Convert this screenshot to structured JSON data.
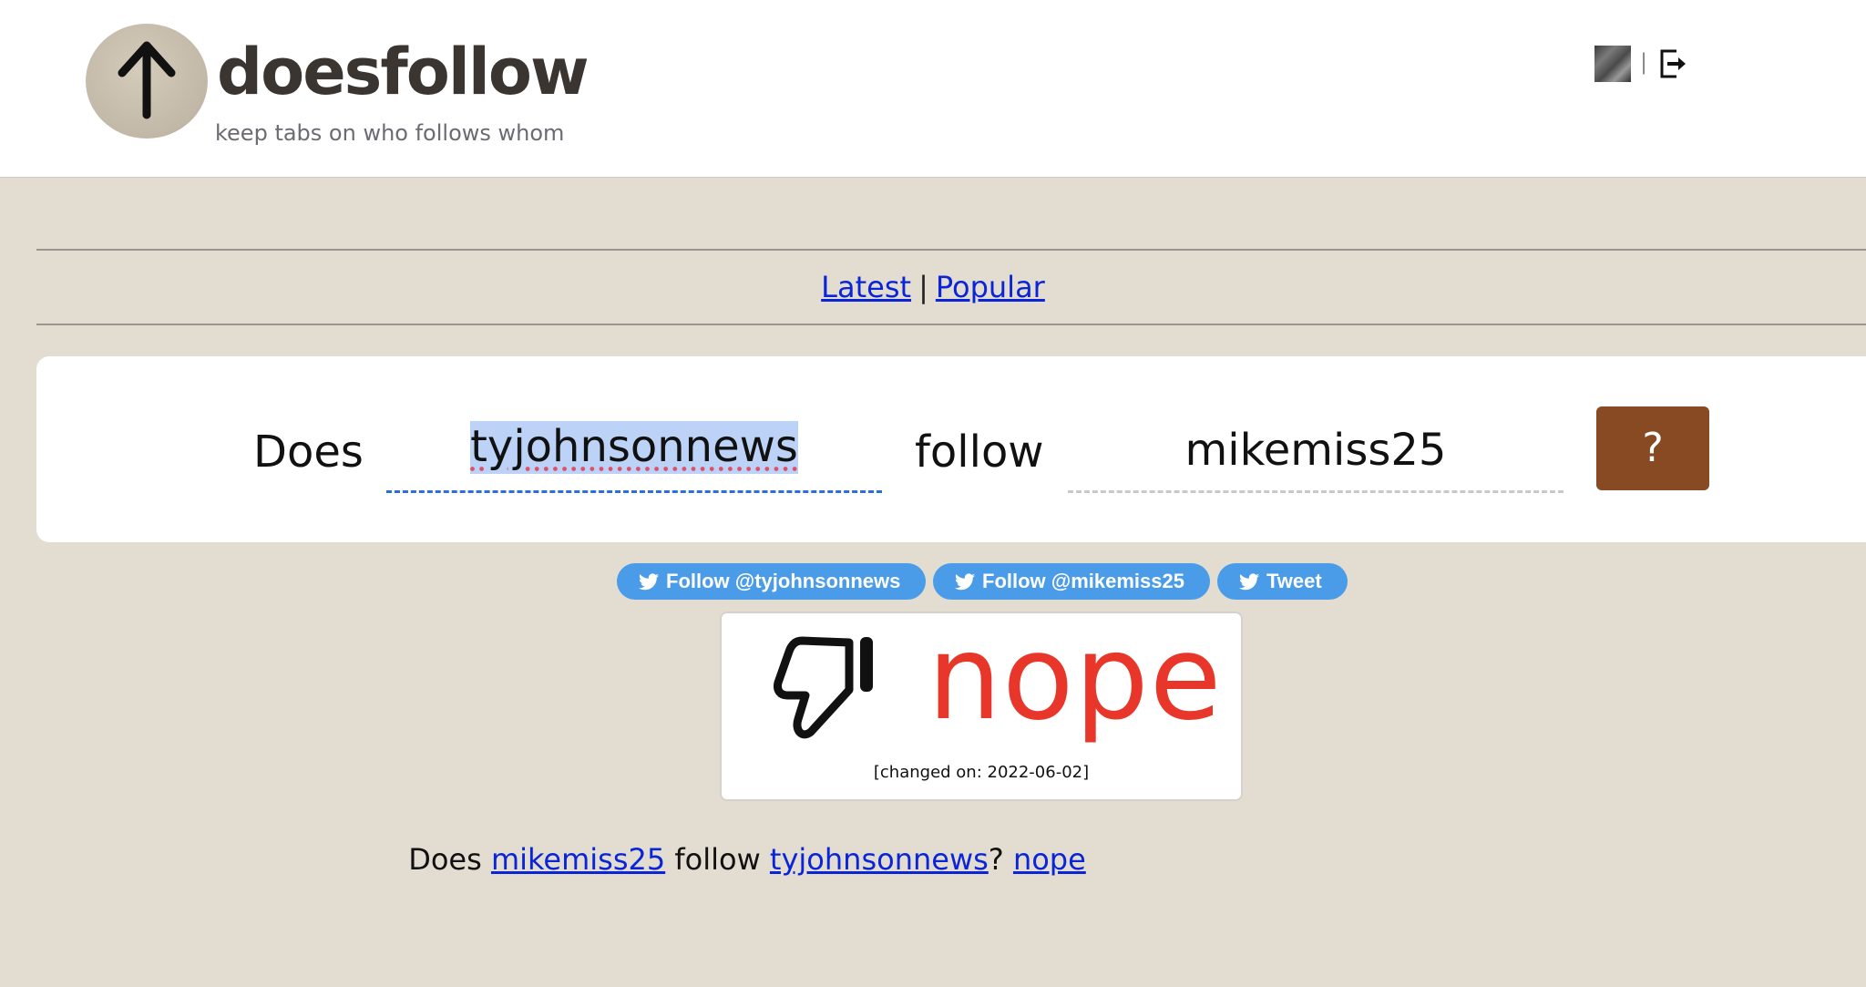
{
  "header": {
    "brand": "doesfollow",
    "tagline": "keep tabs on who follows whom",
    "logo_icon": "up-arrow-icon",
    "user_avatar_icon": "user-avatar",
    "separator": "|",
    "logout_icon": "logout-icon"
  },
  "nav": {
    "latest": "Latest",
    "separator": "|",
    "popular": "Popular"
  },
  "query": {
    "does_label": "Does",
    "follower": "tyjohnsonnews",
    "follow_label": "follow",
    "followee": "mikemiss25",
    "ask_button": "?"
  },
  "share_buttons": {
    "follow_first": "Follow @tyjohnsonnews",
    "follow_second": "Follow @mikemiss25",
    "tweet": "Tweet",
    "icon": "twitter-bird-icon",
    "color": "#4a9ce8"
  },
  "result": {
    "icon": "thumbs-down-icon",
    "verdict": "nope",
    "verdict_color": "#e9362a",
    "changed": "[changed on: 2022-06-02]"
  },
  "reverse": {
    "prefix": "Does",
    "user_a": "mikemiss25",
    "middle": "follow",
    "user_b": "tyjohnsonnews",
    "qmark": "?",
    "answer": "nope"
  },
  "colors": {
    "background": "#e3ddd1",
    "ask_button": "#874a23",
    "link": "#0a25d8",
    "focus_dash": "#2b6fdc"
  }
}
